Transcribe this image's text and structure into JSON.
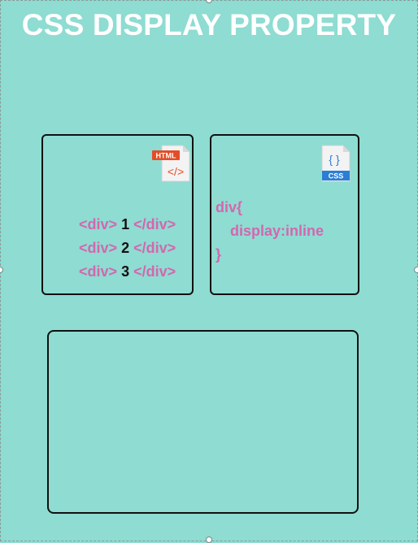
{
  "title": "CSS DISPLAY PROPERTY",
  "colors": {
    "background": "#8edcd2",
    "code_pink": "#d367ae",
    "number_black": "#111111",
    "html_badge": "#e44d26",
    "css_badge": "#2a7fd4"
  },
  "html_card": {
    "badge_label": "HTML",
    "icon": "html-file-icon",
    "lines": [
      {
        "open": "<div>",
        "number": "1",
        "close": "</div>"
      },
      {
        "open": "<div>",
        "number": "2",
        "close": "</div>"
      },
      {
        "open": "<div>",
        "number": "3",
        "close": "</div>"
      }
    ]
  },
  "css_card": {
    "badge_label": "CSS",
    "icon": "css-file-icon",
    "lines": [
      "div{",
      "display:inline",
      "}"
    ]
  }
}
